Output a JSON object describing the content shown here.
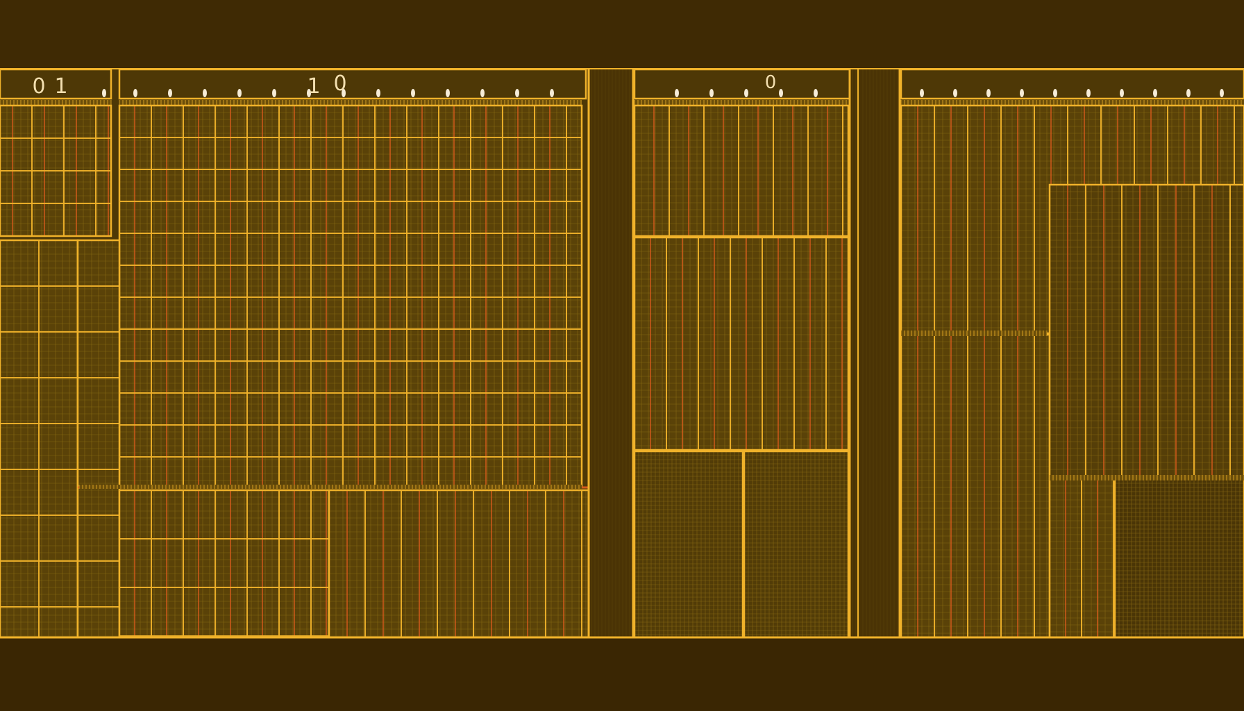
{
  "colors": {
    "background": "#3f2a04",
    "strip_band": "#4a3305",
    "panel_fill": "#5a4208",
    "panel_fill_dark": "#4e3806",
    "grid_major": "#f0b22a",
    "grid_red": "#d65a1c",
    "grid_minor": "#8a6a14",
    "label": "#f3dfb0",
    "tick_dot": "#f6ecd8"
  },
  "labels": {
    "label_a": "0",
    "label_b": "1",
    "label_c": "1",
    "label_d": "0",
    "label_e": "0"
  },
  "icons": {
    "tick_marker": "tick-dot-icon"
  }
}
